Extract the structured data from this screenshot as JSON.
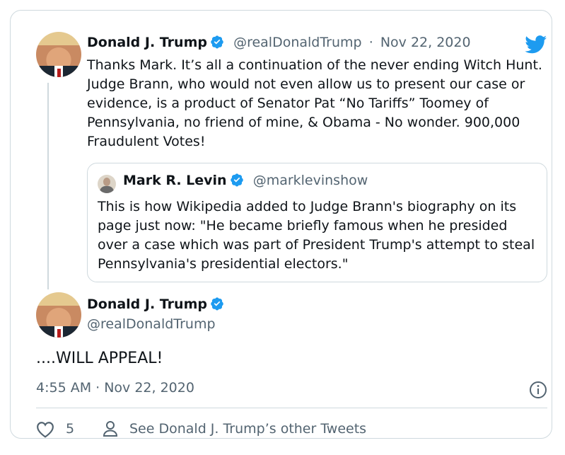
{
  "tweet": {
    "author_name": "Donald J. Trump",
    "author_handle": "@realDonaldTrump",
    "separator": "·",
    "date": "Nov 22, 2020",
    "text": "Thanks Mark. It’s all a continuation of the never ending Witch Hunt. Judge Brann, who would not even allow us to present our case or evidence, is a product of Senator Pat “No Tariffs” Toomey of Pennsylvania, no friend of mine, & Obama - No wonder. 900,000 Fraudulent Votes!",
    "quote": {
      "author_name": "Mark R. Levin",
      "author_handle": "@marklevinshow",
      "text": "This is how Wikipedia added to Judge Brann's biography on its page just now: \"He became briefly famous when he presided over a case which was part of President Trump's attempt to steal Pennsylvania's presidential electors.\""
    }
  },
  "reply": {
    "author_name": "Donald J. Trump",
    "author_handle": "@realDonaldTrump",
    "text": "....WILL APPEAL!",
    "timestamp": "4:55 AM · Nov 22, 2020",
    "like_count": "5",
    "see_more_label": "See Donald J. Trump’s other Tweets"
  },
  "icons": {
    "verified": "verified-badge-icon",
    "twitter": "twitter-bird-icon",
    "info": "info-icon",
    "like": "heart-icon",
    "person": "person-icon"
  },
  "colors": {
    "twitter_blue": "#1d9bf0",
    "secondary_text": "#536471",
    "border": "#cfd9de"
  }
}
